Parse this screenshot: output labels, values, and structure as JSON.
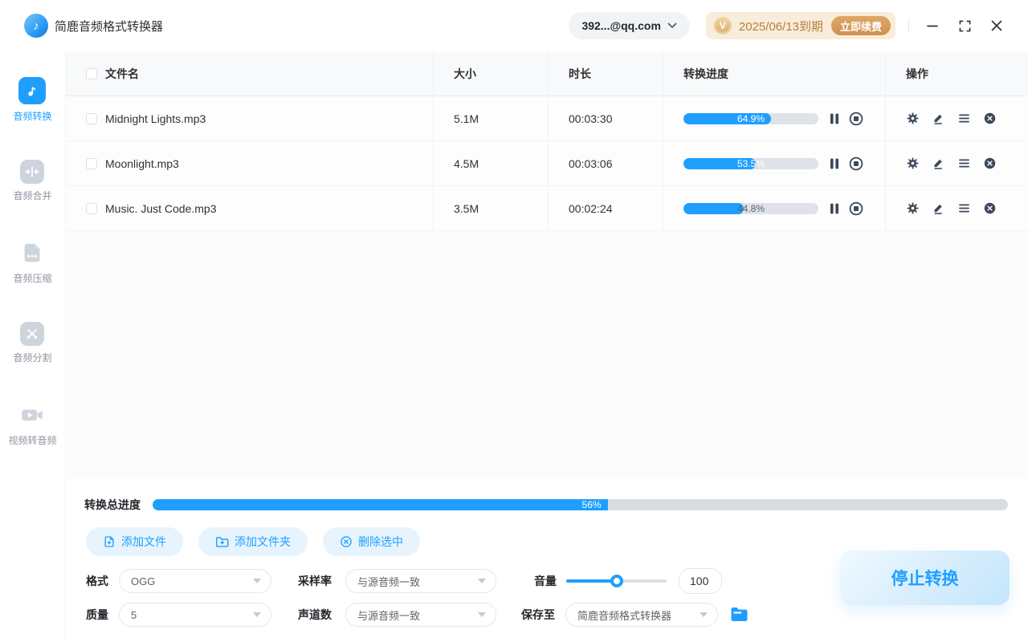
{
  "app": {
    "title": "简鹿音频格式转换器"
  },
  "topbar": {
    "account": "392...@qq.com",
    "vip": {
      "badge": "V",
      "expiry": "2025/06/13到期",
      "renew_label": "立即续费"
    }
  },
  "sidebar": {
    "items": [
      {
        "label": "音频转换",
        "active": true
      },
      {
        "label": "音频合并",
        "active": false
      },
      {
        "label": "音频压缩",
        "active": false
      },
      {
        "label": "音频分割",
        "active": false
      },
      {
        "label": "视频转音频",
        "active": false
      }
    ]
  },
  "table": {
    "headers": {
      "name": "文件名",
      "size": "大小",
      "duration": "时长",
      "progress": "转换进度",
      "actions": "操作"
    },
    "rows": [
      {
        "name": "Midnight Lights.mp3",
        "size": "5.1M",
        "duration": "00:03:30",
        "progress": 64.9,
        "progress_label": "64.9%"
      },
      {
        "name": "Moonlight.mp3",
        "size": "4.5M",
        "duration": "00:03:06",
        "progress": 53.5,
        "progress_label": "53.5%"
      },
      {
        "name": "Music. Just Code.mp3",
        "size": "3.5M",
        "duration": "00:02:24",
        "progress": 44.8,
        "progress_label": "44.8%"
      }
    ]
  },
  "footer": {
    "total_progress_label": "转换总进度",
    "total_progress_text": "56%",
    "total_fill_percent": 53.2,
    "buttons": {
      "add_file": "添加文件",
      "add_folder": "添加文件夹",
      "delete_selected": "删除选中"
    },
    "form": {
      "format_label": "格式",
      "format_value": "OGG",
      "sample_rate_label": "采样率",
      "sample_rate_value": "与源音频一致",
      "volume_label": "音量",
      "volume_value": "100",
      "volume_percent": 50,
      "quality_label": "质量",
      "quality_value": "5",
      "channels_label": "声道数",
      "channels_value": "与源音频一致",
      "save_to_label": "保存至",
      "save_to_value": "简鹿音频格式转换器"
    },
    "stop_button": "停止转换"
  },
  "colors": {
    "accent": "#1e9fff",
    "progress_track": "#dfe2e8",
    "vip_text": "#b87d3e",
    "icon_slate": "#3b4859"
  }
}
